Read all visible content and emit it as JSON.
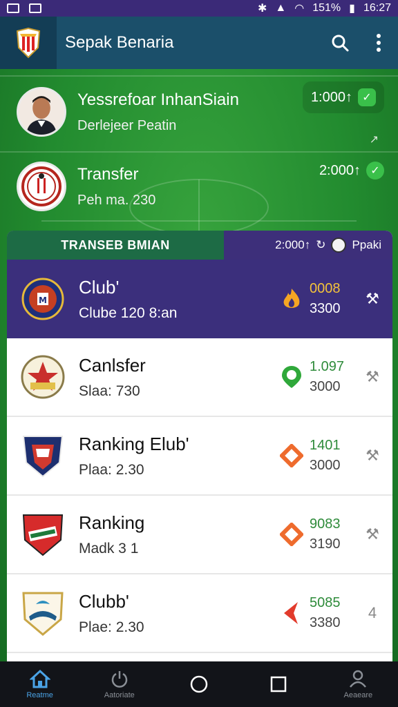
{
  "status_bar": {
    "battery": "151%",
    "time": "16:27"
  },
  "app_bar": {
    "title": "Sepak Benaria",
    "logo": "club-crest-icon",
    "actions": [
      "search-icon",
      "more-vert-icon"
    ]
  },
  "players": [
    {
      "name": "Yessrefoar InhanSiain",
      "subtitle": "Derlejeer Peatin",
      "price": "1:000↑",
      "avatar": "player-photo",
      "status_icon": "check-icon"
    },
    {
      "name": "Transfer",
      "subtitle": "Peh ma. 230",
      "price": "2:000↑",
      "avatar": "club-crest-icon",
      "status_icon": "check-icon"
    }
  ],
  "panel": {
    "tab_label": "TRANSEB BMIAN",
    "meta_value": "2:000↑",
    "meta_label": "Ppaki",
    "meta_icons": [
      "refresh-icon",
      "ball-icon"
    ]
  },
  "clubs": [
    {
      "name": "Club'",
      "subtitle": "Clube 120 8:an",
      "stat_top": "0008",
      "stat_bot": "3300",
      "stat_icon": "fire-icon",
      "action_icon": "tools-icon"
    },
    {
      "name": "Canlsfer",
      "subtitle": "Slaa: 730",
      "stat_top": "1.097",
      "stat_bot": "3000",
      "stat_icon": "location-pin-icon",
      "action_icon": "tools-icon"
    },
    {
      "name": "Ranking Elub'",
      "subtitle": "Plaa: 2.30",
      "stat_top": "1401",
      "stat_bot": "3000",
      "stat_icon": "diamond-icon",
      "action_icon": "tools-icon"
    },
    {
      "name": "Ranking",
      "subtitle": "Madk 3   1",
      "stat_top": "9083",
      "stat_bot": "3190",
      "stat_icon": "diamond-icon",
      "action_icon": "tools-icon"
    },
    {
      "name": "Clubb'",
      "subtitle": "Plae: 2.30",
      "stat_top": "5085",
      "stat_bot": "3380",
      "stat_icon": "arrow-icon",
      "action_icon": "4"
    }
  ],
  "bottom_nav": [
    {
      "label": "Reatme",
      "icon": "home-icon",
      "active": true
    },
    {
      "label": "Aatoriate",
      "icon": "power-icon",
      "active": false
    },
    {
      "label": "",
      "icon": "circle-icon",
      "active": false
    },
    {
      "label": "",
      "icon": "square-icon",
      "active": false
    },
    {
      "label": "Aeaeare",
      "icon": "profile-icon",
      "active": false
    }
  ],
  "colors": {
    "accent_purple": "#3b2f7c",
    "pitch_green": "#228b2f",
    "check_green": "#3ac04a",
    "gold": "#f4c33a"
  }
}
